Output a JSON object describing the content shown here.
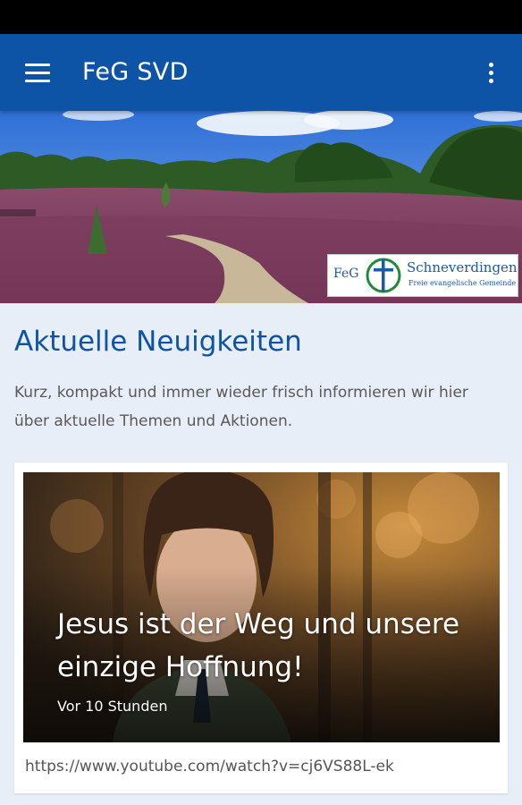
{
  "app_bar": {
    "title": "FeG SVD",
    "background": "#0d53a6",
    "menu_icon": "hamburger-menu-icon",
    "overflow_icon": "more-vertical-icon"
  },
  "hero": {
    "logo": {
      "short_name": "FeG",
      "name": "Schneverdingen",
      "subtitle": "Freie evangelische Gemeinde"
    }
  },
  "main": {
    "section_title": "Aktuelle Neuigkeiten",
    "section_description": "Kurz, kompakt und immer wieder frisch informieren wir hier über aktuelle Themen und Aktionen.",
    "posts": [
      {
        "title": "Jesus ist der Weg und unsere einzige Hoffnung!",
        "time": "Vor 10 Stunden",
        "url": "https://www.youtube.com/watch?v=cj6VS88L-ek"
      }
    ]
  },
  "colors": {
    "accent": "#0d53a6",
    "page_background": "#e8eef7"
  }
}
